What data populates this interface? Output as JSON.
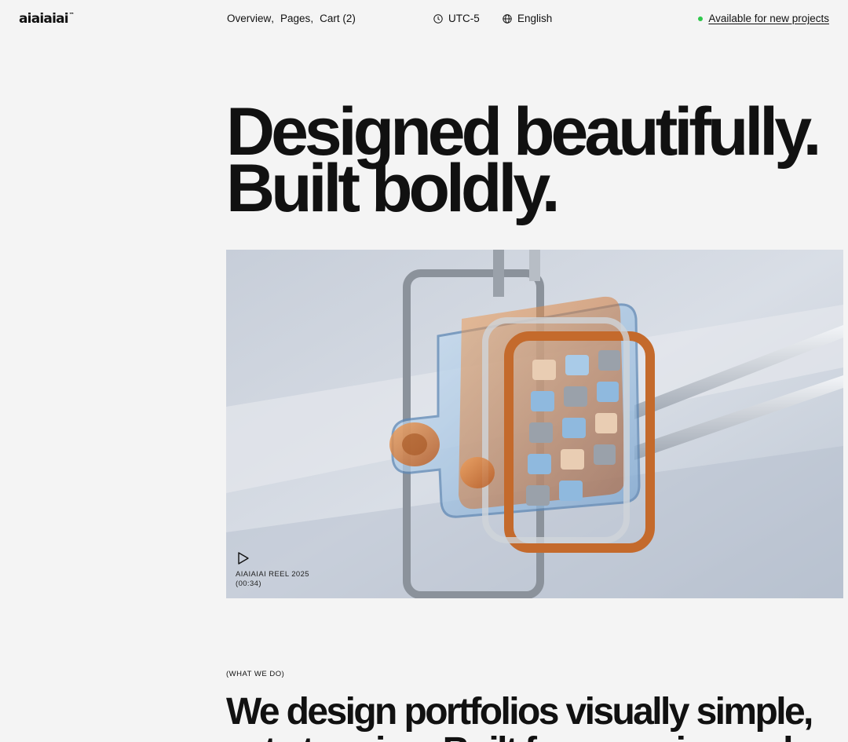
{
  "header": {
    "logo": "aiaiaiai",
    "logo_mark": "™",
    "nav": [
      {
        "label": "Overview",
        "sep": ","
      },
      {
        "label": "Pages",
        "sep": ","
      },
      {
        "label": "Cart (2)",
        "sep": ""
      }
    ],
    "timezone": "UTC-5",
    "language": "English",
    "availability": "Available for new projects",
    "availability_color": "#2ec84b"
  },
  "hero": {
    "line1": "Designed beautifully.",
    "line2": "Built boldly."
  },
  "reel": {
    "title": "AIAIAIAI REEL 2025",
    "duration": "(00:34)",
    "play_icon": "play-icon"
  },
  "what_we_do": {
    "eyebrow": "(WHAT WE DO)",
    "line1": "We design portfolios visually simple,",
    "line2": "yet stunning. Built for agencies and"
  },
  "colors": {
    "background": "#f4f4f4",
    "text": "#111111",
    "accent_orange": "#d9702a",
    "accent_blue": "#8fb9de"
  }
}
